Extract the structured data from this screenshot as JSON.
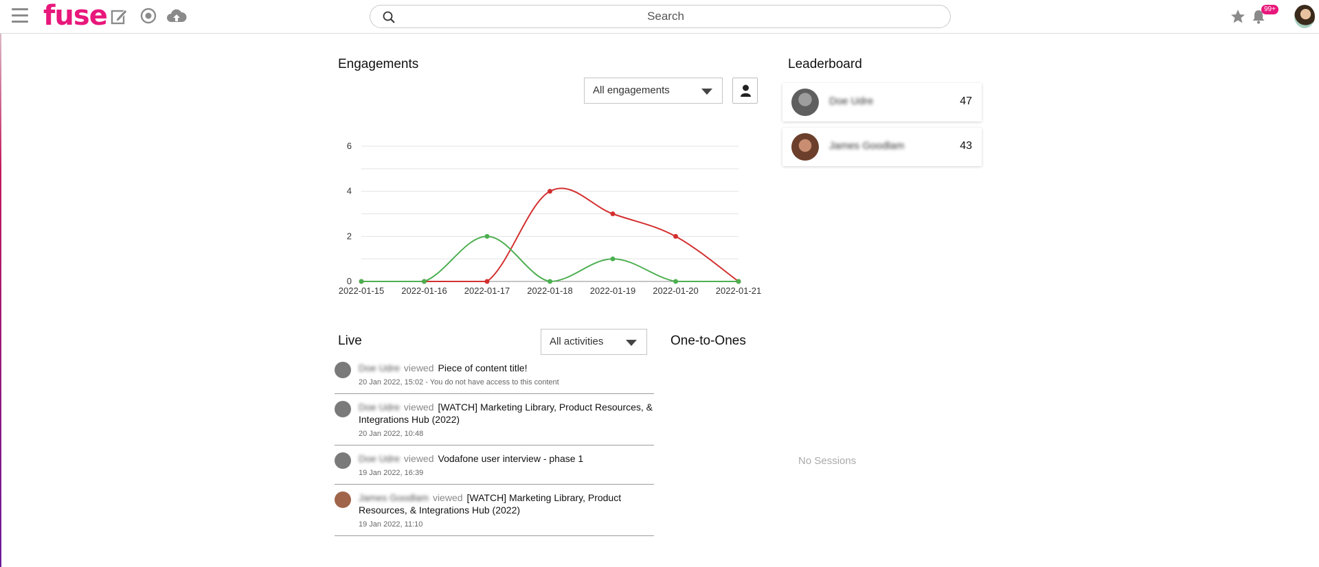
{
  "header": {
    "logo": "fuse",
    "search_placeholder": "Search",
    "notification_count": "99+"
  },
  "engagements": {
    "title": "Engagements",
    "filter_value": "All engagements"
  },
  "chart_data": {
    "type": "line",
    "x": [
      "2022-01-15",
      "2022-01-16",
      "2022-01-17",
      "2022-01-18",
      "2022-01-19",
      "2022-01-20",
      "2022-01-21"
    ],
    "series": [
      {
        "color": "#d32f2f",
        "values": [
          0,
          0,
          0,
          4,
          3,
          2,
          0
        ]
      },
      {
        "color": "#4caf50",
        "values": [
          0,
          0,
          2,
          0,
          1,
          0,
          0
        ]
      }
    ],
    "yticks": [
      0,
      2,
      4,
      6
    ],
    "ylim": [
      0,
      6
    ],
    "grid": true
  },
  "leaderboard": {
    "title": "Leaderboard",
    "entries": [
      {
        "name": "Doe Udre",
        "score": "47"
      },
      {
        "name": "James Goodlam",
        "score": "43"
      }
    ]
  },
  "live": {
    "title": "Live",
    "filter_value": "All activities",
    "items": [
      {
        "user": "Doe Udre",
        "verb": "viewed",
        "content": "Piece of content title!",
        "meta": "20 Jan 2022, 15:02 - You do not have access to this content"
      },
      {
        "user": "Doe Udre",
        "verb": "viewed",
        "content": "[WATCH] Marketing Library, Product Resources, & Integrations Hub (2022)",
        "meta": "20 Jan 2022, 10:48"
      },
      {
        "user": "Doe Udre",
        "verb": "viewed",
        "content": "Vodafone user interview - phase 1",
        "meta": "19 Jan 2022, 16:39"
      },
      {
        "user": "James Goodlam",
        "verb": "viewed",
        "content": "[WATCH] Marketing Library, Product Resources, & Integrations Hub (2022)",
        "meta": "19 Jan 2022, 11:10"
      }
    ]
  },
  "one_to_ones": {
    "title": "One-to-Ones",
    "empty_text": "No Sessions"
  }
}
